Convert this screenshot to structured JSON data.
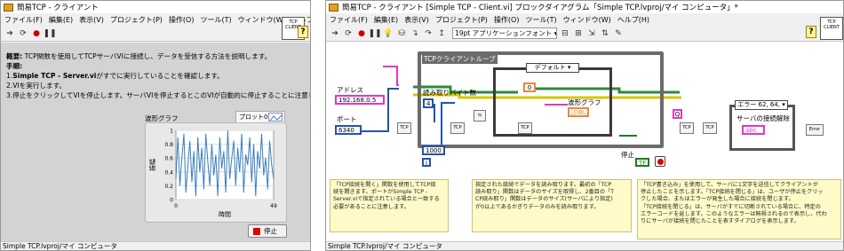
{
  "front_panel": {
    "title": "簡易TCP - クライアント",
    "menu": [
      "ファイル(F)",
      "編集(E)",
      "表示(V)",
      "プロジェクト(P)",
      "操作(O)",
      "ツール(T)",
      "ウィンドウ(W)",
      "ヘルプ(H)"
    ],
    "description": {
      "line1_bold": "概要:",
      "line1": " TCP関数を使用してTCPサーバVIに接続し、データを受信する方法を説明します。",
      "heading": "手順:",
      "step1_prefix": "1.",
      "step1_bold": "Simple TCP - Server.vi",
      "step1": "がすでに実行していることを確認します。",
      "step2": "2.VIを実行します。",
      "step3": "3.停止をクリックしてVIを停止します。サーバVIを停止するとこのVIが自動的に停止することに注意します。"
    },
    "graph": {
      "title": "波形グラフ",
      "legend": "プロット0",
      "ylabel": "振幅",
      "xlabel": "時間",
      "yticks": [
        "1",
        "0.8",
        "0.6",
        "0.4",
        "0.2",
        "0"
      ],
      "xticks": [
        "0",
        "49"
      ]
    },
    "chart_data": {
      "type": "line",
      "title": "波形グラフ",
      "xlabel": "時間",
      "ylabel": "振幅",
      "xlim": [
        0,
        49
      ],
      "ylim": [
        0,
        1
      ],
      "series": [
        {
          "name": "プロット0",
          "values": [
            0.3,
            0.9,
            0.2,
            0.6,
            0.95,
            0.1,
            0.5,
            0.85,
            0.25,
            0.7,
            0.05,
            0.9,
            0.4,
            0.75,
            0.15,
            0.95,
            0.55,
            0.2,
            0.8,
            0.35,
            0.65,
            0.05,
            0.9,
            0.45,
            0.7,
            0.1,
            1.0,
            0.3,
            0.6,
            0.85,
            0.2,
            0.75,
            0.4,
            0.95,
            0.1,
            0.65,
            0.5,
            0.9,
            0.25,
            0.8,
            0.05,
            0.7,
            0.45,
            0.95,
            0.35,
            0.6,
            0.15,
            0.85,
            0.5,
            0.3
          ]
        }
      ]
    },
    "stop_label": "停止",
    "status": "Simple TCP.lvproj/マイ コンピュータ",
    "vi_icon": "TCP\nCLIENT"
  },
  "block_diagram": {
    "title": "簡易TCP - クライアント [Simple TCP - Client.vi] ブロックダイアグラム「Simple TCP.lvproj/マイ コンピュータ」*",
    "menu": [
      "ファイル(F)",
      "編集(E)",
      "表示(V)",
      "プロジェクト(P)",
      "操作(O)",
      "ツール(T)",
      "ウィンドウ(W)",
      "ヘルプ(H)"
    ],
    "font": "19pt アプリケーションフォント",
    "loop_label": "TCPクライアントループ",
    "address_label": "アドレス",
    "address_value": "192.168.0.5",
    "port_label": "ポート",
    "port_value": "6340",
    "bytes_label": "読み取りバイト数",
    "bytes_value": "4",
    "case_label": "デフォルト",
    "case_zero": "0",
    "graph_label": "波形グラフ",
    "const_1000": "1000",
    "iter": "i",
    "stop_label": "停止",
    "q_label": "Q",
    "error_case": "エラー 62, 64,",
    "disconnect_label": "サーバの接続解除",
    "comment1": [
      "「TCP接続を開く」関数を使用してTCP接",
      "続を開きます。ポートがSimple TCP -",
      "Server.viで指定されている場合と一致する",
      "必要があることに注意します。"
    ],
    "comment2": [
      "指定された接続でデータを読み取ります。最初の「TCP",
      "読み取り」関数はデータのサイズを取得し、2番目の「T",
      "CP読み取り」関数はデータのサイズ(サーバにより指定)",
      "が0以上であるかぎりデータのみを読み取ります。"
    ],
    "comment3": [
      "「TCP書き込み」を使用して、サーバに1文字を送信してクライアントが",
      "停止したことを示します。「TCP接続を閉じる」は、ユーザが停止をクリッ",
      "クした場合、またはエラーが発生した場合に接続を閉じます。",
      "",
      "「TCP接続を閉じる」は、サーバがすでに切断されている場合に、特定の",
      "エラーコードを返します。このようなエラーは無視されるので表示し、代わ",
      "りにサーバが接続を閉じたことを表すダイアログを表示します。"
    ],
    "status": "Simple TCP.lvproj/マイ コンピュータ"
  }
}
